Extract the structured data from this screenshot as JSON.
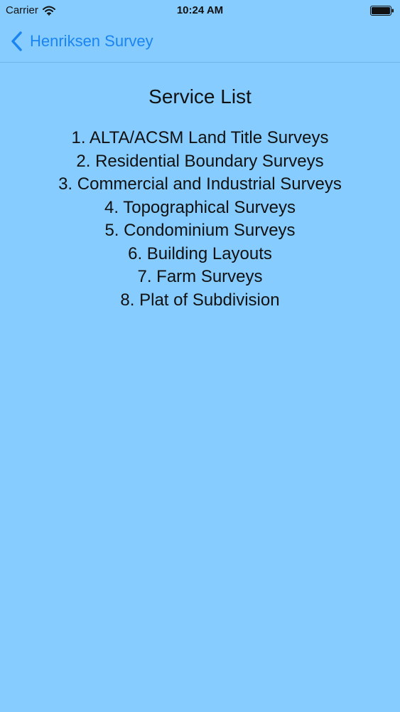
{
  "status_bar": {
    "carrier": "Carrier",
    "time": "10:24 AM"
  },
  "nav": {
    "back_label": "Henriksen Survey"
  },
  "main": {
    "title": "Service List",
    "services": [
      "1. ALTA/ACSM Land Title Surveys",
      "2. Residential Boundary Surveys",
      "3. Commercial and Industrial Surveys",
      "4. Topographical Surveys",
      "5. Condominium Surveys",
      "6. Building Layouts",
      "7. Farm Surveys",
      "8. Plat of Subdivision"
    ]
  },
  "icons": {
    "wifi": "wifi-icon",
    "battery": "battery-icon",
    "back": "chevron-left-icon"
  },
  "colors": {
    "background": "#87CCFF",
    "accent": "#1a84f0",
    "text": "#111111"
  }
}
